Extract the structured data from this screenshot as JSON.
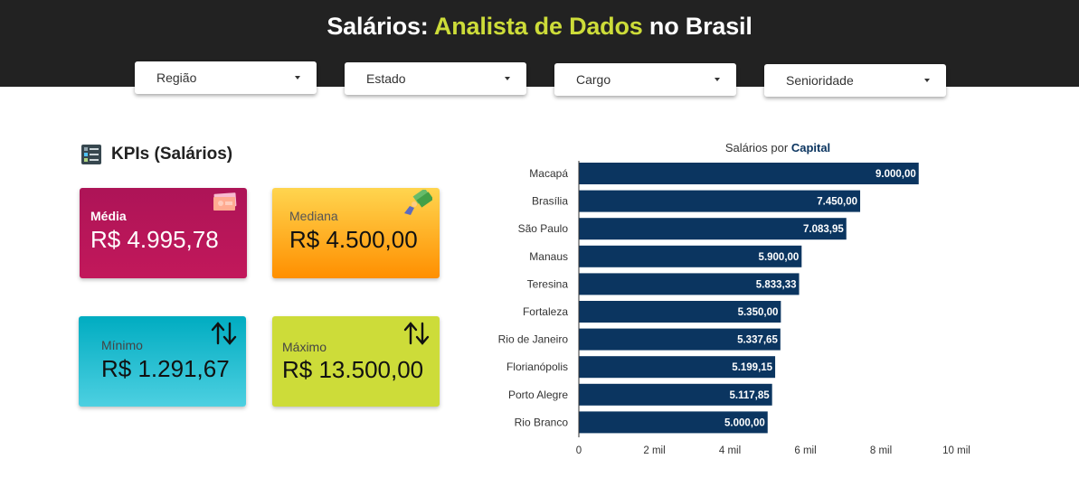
{
  "header": {
    "title_prefix": "Salários:",
    "title_accent": "Analista de Dados",
    "title_suffix": "no Brasil",
    "accent_color": "#cddc39",
    "background": "#222222"
  },
  "filters": [
    {
      "label": "Região"
    },
    {
      "label": "Estado"
    },
    {
      "label": "Cargo"
    },
    {
      "label": "Senioridade"
    }
  ],
  "kpis": {
    "title": "KPIs (Salários)",
    "title_icon": "dashboard-list-icon",
    "cards": [
      {
        "label": "Média",
        "value": "R$ 4.995,78",
        "icon": "money-bill-icon",
        "colors": [
          "#ad1457",
          "#c2185b"
        ]
      },
      {
        "label": "Mediana",
        "value": "R$ 4.500,00",
        "icon": "money-hand-icon",
        "colors": [
          "#ffd54f",
          "#ff8f00"
        ]
      },
      {
        "label": "Mínimo",
        "value": "R$ 1.291,67",
        "icon": "sort-arrows-icon",
        "colors": [
          "#00acc1",
          "#4dd0e1"
        ]
      },
      {
        "label": "Máximo",
        "value": "R$ 13.500,00",
        "icon": "sort-arrows-icon",
        "colors": [
          "#cddc39",
          "#cddc39"
        ]
      }
    ]
  },
  "chart_data": {
    "type": "bar",
    "orientation": "horizontal",
    "title_prefix": "Salários por",
    "title_emphasis": "Capital",
    "categories": [
      "Macapá",
      "Brasília",
      "São Paulo",
      "Manaus",
      "Teresina",
      "Fortaleza",
      "Rio de Janeiro",
      "Florianópolis",
      "Porto Alegre",
      "Rio Branco"
    ],
    "values": [
      9000.0,
      7450.0,
      7083.95,
      5900.0,
      5833.33,
      5350.0,
      5337.65,
      5199.15,
      5117.85,
      5000.0
    ],
    "value_labels": [
      "9.000,00",
      "7.450,00",
      "7.083,95",
      "5.900,00",
      "5.833,33",
      "5.350,00",
      "5.337,65",
      "5.199,15",
      "5.117,85",
      "5.000,00"
    ],
    "xlim": [
      0,
      10000
    ],
    "xticks": [
      0,
      2000,
      4000,
      6000,
      8000,
      10000
    ],
    "xtick_labels": [
      "0",
      "2 mil",
      "4 mil",
      "6 mil",
      "8 mil",
      "10 mil"
    ],
    "bar_color": "#0b3560",
    "grid": false
  }
}
